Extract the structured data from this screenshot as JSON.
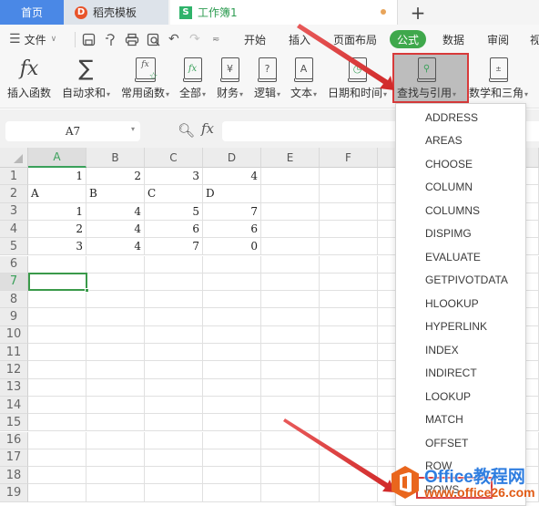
{
  "tabs": {
    "home": "首页",
    "template": "稻壳模板",
    "template_icon": "D",
    "workbook": "工作簿1",
    "workbook_icon": "S",
    "new_tab": "+"
  },
  "menubar": {
    "file": "文件",
    "items": [
      "开始",
      "插入",
      "页面布局",
      "公式",
      "数据",
      "审阅",
      "视"
    ],
    "active": "公式"
  },
  "ribbon": {
    "buttons": [
      {
        "label": "插入函数",
        "icon": "fx-icon",
        "dropdown": false
      },
      {
        "label": "自动求和",
        "icon": "sigma-icon",
        "dropdown": true
      },
      {
        "label": "常用函数",
        "icon": "common-functions-icon",
        "dropdown": true
      },
      {
        "label": "全部",
        "icon": "all-functions-icon",
        "dropdown": true
      },
      {
        "label": "财务",
        "icon": "finance-icon",
        "dropdown": true
      },
      {
        "label": "逻辑",
        "icon": "logic-icon",
        "dropdown": true
      },
      {
        "label": "文本",
        "icon": "text-icon",
        "dropdown": true
      },
      {
        "label": "日期和时间",
        "icon": "datetime-icon",
        "dropdown": true
      },
      {
        "label": "查找与引用",
        "icon": "lookup-icon",
        "dropdown": true
      },
      {
        "label": "数学和三角",
        "icon": "math-icon",
        "dropdown": true
      }
    ],
    "icon_glyphs": {
      "fx": "fx",
      "sigma": "∑",
      "finance": "¥",
      "logic": "?",
      "text": "A",
      "all": "fx",
      "common": "fx"
    }
  },
  "formula_bar": {
    "name_box": "A7",
    "fx_label": "fx",
    "formula": ""
  },
  "sheet": {
    "columns": [
      "A",
      "B",
      "C",
      "D",
      "E",
      "F"
    ],
    "rows": [
      "1",
      "2",
      "3",
      "4",
      "5",
      "6",
      "7",
      "8",
      "9",
      "10",
      "11",
      "12",
      "13",
      "14",
      "15",
      "16",
      "17",
      "18",
      "19"
    ],
    "active_cell": "A7",
    "cells": [
      [
        "1",
        "2",
        "3",
        "4"
      ],
      [
        "A",
        "B",
        "C",
        "D"
      ],
      [
        "1",
        "4",
        "5",
        "7"
      ],
      [
        "2",
        "4",
        "6",
        "6"
      ],
      [
        "3",
        "4",
        "7",
        "0"
      ]
    ]
  },
  "dropdown": {
    "items": [
      "ADDRESS",
      "AREAS",
      "CHOOSE",
      "COLUMN",
      "COLUMNS",
      "DISPIMG",
      "EVALUATE",
      "GETPIVOTDATA",
      "HLOOKUP",
      "HYPERLINK",
      "INDEX",
      "INDIRECT",
      "LOOKUP",
      "MATCH",
      "OFFSET",
      "ROW",
      "ROWS"
    ]
  },
  "watermark": {
    "title": "Office教程网",
    "url": "www.office26.com"
  },
  "colors": {
    "accent_green": "#3fa84c",
    "home_tab_blue": "#4a88e6",
    "annotation_red": "#d83a3a",
    "watermark_orange": "#e05a14"
  }
}
